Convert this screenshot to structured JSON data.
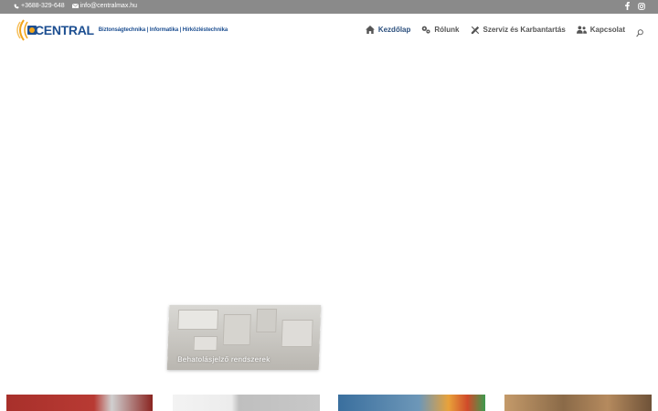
{
  "topbar": {
    "phone": "+3688-329-648",
    "email": "info@centralmax.hu",
    "social": [
      "facebook-icon",
      "instagram-icon"
    ]
  },
  "header": {
    "logo_text": "CENTRAL",
    "tagline": "Biztonságtechnika | Informatika | Hírközléstechnika"
  },
  "nav": {
    "items": [
      {
        "label": "Kezdőlap",
        "icon": "home-icon",
        "active": true
      },
      {
        "label": "Rólunk",
        "icon": "gears-icon",
        "active": false
      },
      {
        "label": "Szerviz és Karbantartás",
        "icon": "tools-icon",
        "active": false
      },
      {
        "label": "Kapcsolat",
        "icon": "users-icon",
        "active": false
      }
    ]
  },
  "cards": [
    {
      "label": "Behatolásjelző rendszerek"
    }
  ],
  "colors": {
    "topbar": "#8a8a8a",
    "brand_blue": "#1d4f91",
    "nav_active": "#2b4f7d",
    "nav_text": "#555555",
    "logo_orange": "#f2a51a"
  }
}
